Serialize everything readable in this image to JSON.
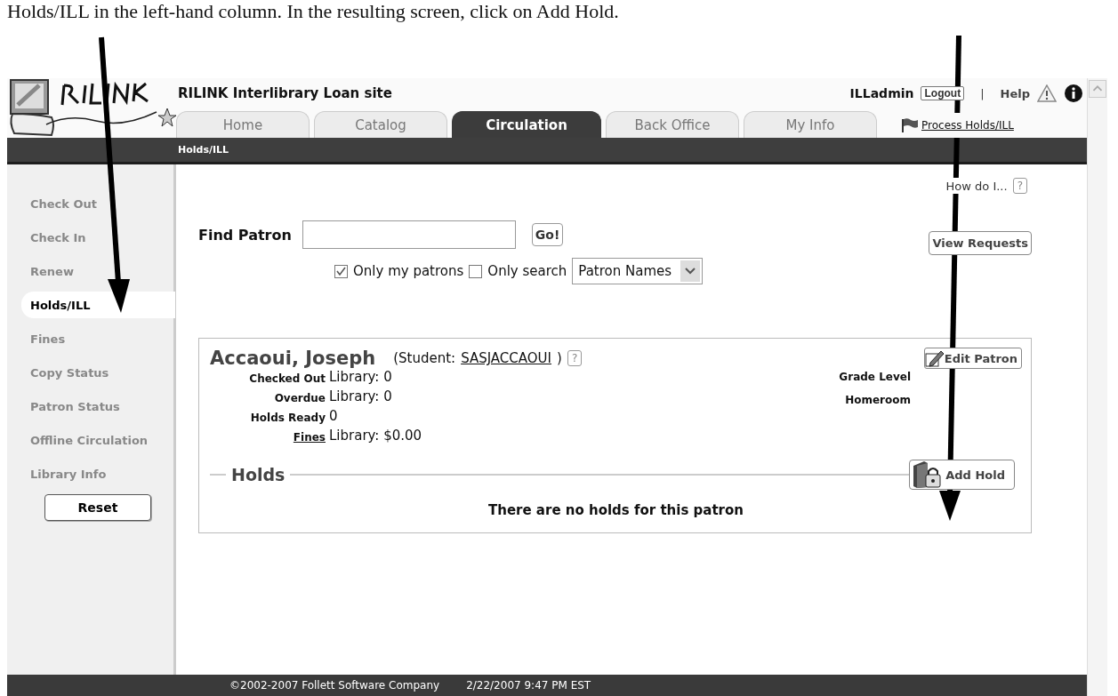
{
  "instruction": "Holds/ILL in the left-hand column.  In the resulting screen, click on Add Hold.",
  "header": {
    "site_title": "RILINK Interlibrary Loan site",
    "user": "ILLadmin",
    "logout": "Logout",
    "separator": "|",
    "help": "Help"
  },
  "tabs": [
    {
      "label": "Home",
      "selected": false
    },
    {
      "label": "Catalog",
      "selected": false
    },
    {
      "label": "Circulation",
      "selected": true
    },
    {
      "label": "Back Office",
      "selected": false
    },
    {
      "label": "My Info",
      "selected": false
    }
  ],
  "process_link": "Process Holds/ILL",
  "breadcrumb": "Holds/ILL",
  "sidebar": {
    "items": [
      {
        "label": "Check Out",
        "selected": false
      },
      {
        "label": "Check In",
        "selected": false
      },
      {
        "label": "Renew",
        "selected": false
      },
      {
        "label": "Holds/ILL",
        "selected": true
      },
      {
        "label": "Fines",
        "selected": false
      },
      {
        "label": "Copy Status",
        "selected": false
      },
      {
        "label": "Patron Status",
        "selected": false
      },
      {
        "label": "Offline Circulation",
        "selected": false
      },
      {
        "label": "Library Info",
        "selected": false
      }
    ],
    "reset": "Reset"
  },
  "how_do_i": {
    "label": "How do I...",
    "help": "?"
  },
  "find": {
    "label": "Find Patron",
    "go": "Go!",
    "only_my": {
      "label": "Only my patrons",
      "checked": true
    },
    "only_search": {
      "label": "Only search",
      "checked": false
    },
    "search_type": "Patron Names"
  },
  "view_requests": "View Requests",
  "patron": {
    "name": "Accaoui, Joseph",
    "type_prefix": "(Student:",
    "id": "SASJACCAOUI",
    "type_suffix": ")",
    "help": "?",
    "edit": "Edit Patron",
    "fields": [
      {
        "label": "Checked Out",
        "value": "Library: 0",
        "link": false
      },
      {
        "label": "Overdue",
        "value": "Library: 0",
        "link": false
      },
      {
        "label": "Holds Ready",
        "value": "0",
        "link": false
      },
      {
        "label": "Fines",
        "value": "Library: $0.00",
        "link": true
      }
    ],
    "right_fields": [
      "Grade Level",
      "Homeroom"
    ]
  },
  "holds": {
    "title": "Holds",
    "add": "Add Hold",
    "empty": "There are no holds for this patron"
  },
  "footer": {
    "copyright": "©2002-2007  Follett Software Company",
    "timestamp": "2/22/2007 9:47 PM EST"
  }
}
